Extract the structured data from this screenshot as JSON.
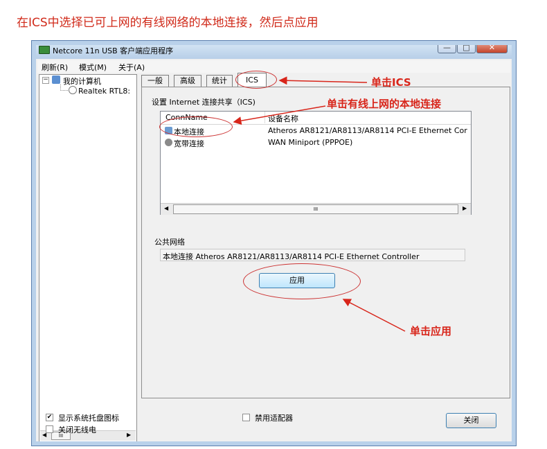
{
  "caption": "在ICS中选择已可上网的有线网络的本地连接，然后点应用",
  "window": {
    "title": "Netcore 11n USB 客户端应用程序",
    "minimize": "—",
    "maximize": "□",
    "close": "✕"
  },
  "menu": [
    "刷新(R)",
    "模式(M)",
    "关于(A)"
  ],
  "tree": {
    "root": "我的计算机",
    "child": "Realtek RTL8:",
    "scroll_mid": "III"
  },
  "tabs": [
    "一般",
    "高级",
    "统计",
    "ICS"
  ],
  "ics": {
    "group_label": "设置 Internet 连接共享（ICS)",
    "columns": [
      "ConnName",
      "设备名称"
    ],
    "rows": [
      {
        "name": "本地连接",
        "device": "Atheros AR8121/AR8113/AR8114 PCI-E Ethernet Cor",
        "icon": "network-icon"
      },
      {
        "name": "宽带连接",
        "device": "WAN Miniport (PPPOE)",
        "icon": "broadband-icon"
      }
    ],
    "scroll_mid": "III",
    "public_label": "公共网络",
    "public_value": "本地连接 Atheros AR8121/AR8113/AR8114 PCI-E Ethernet Controller",
    "apply": "应用"
  },
  "footer": {
    "show_tray": "显示系统托盘图标",
    "show_tray_checked": true,
    "disable_wireless": "关闭无线电",
    "disable_wireless_checked": false,
    "disable_adapter": "禁用适配器",
    "disable_adapter_checked": false,
    "close": "关闭"
  },
  "annotations": {
    "click_ics": "单击ICS",
    "click_local": "单击有线上网的本地连接",
    "click_apply": "单击应用",
    "color": "#d8251a"
  }
}
